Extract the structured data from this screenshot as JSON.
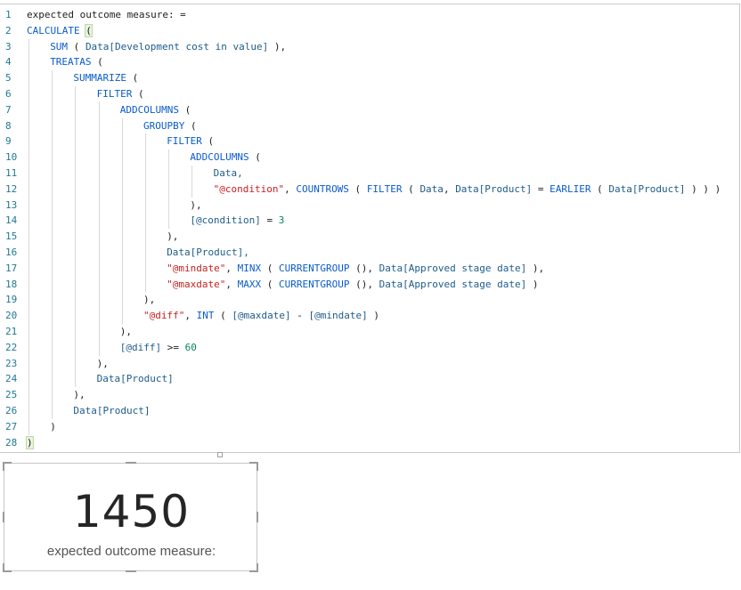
{
  "editor": {
    "lines": [
      {
        "n": "1",
        "indent": 0,
        "parts": [
          {
            "t": "expected outcome measure: =",
            "c": ""
          }
        ]
      },
      {
        "n": "2",
        "indent": 0,
        "parts": [
          {
            "t": "CALCULATE",
            "c": "kw"
          },
          {
            "t": " ",
            "c": ""
          },
          {
            "t": "(",
            "c": "bracket"
          }
        ]
      },
      {
        "n": "3",
        "indent": 1,
        "parts": [
          {
            "t": "SUM",
            "c": "kw"
          },
          {
            "t": " ( ",
            "c": ""
          },
          {
            "t": "Data[Development cost in value]",
            "c": "col"
          },
          {
            "t": " ),",
            "c": ""
          }
        ]
      },
      {
        "n": "4",
        "indent": 1,
        "parts": [
          {
            "t": "TREATAS",
            "c": "kw"
          },
          {
            "t": " (",
            "c": ""
          }
        ]
      },
      {
        "n": "5",
        "indent": 2,
        "parts": [
          {
            "t": "SUMMARIZE",
            "c": "kw"
          },
          {
            "t": " (",
            "c": ""
          }
        ]
      },
      {
        "n": "6",
        "indent": 3,
        "parts": [
          {
            "t": "FILTER",
            "c": "kw"
          },
          {
            "t": " (",
            "c": ""
          }
        ]
      },
      {
        "n": "7",
        "indent": 4,
        "parts": [
          {
            "t": "ADDCOLUMNS",
            "c": "kw"
          },
          {
            "t": " (",
            "c": ""
          }
        ]
      },
      {
        "n": "8",
        "indent": 5,
        "parts": [
          {
            "t": "GROUPBY",
            "c": "kw"
          },
          {
            "t": " (",
            "c": ""
          }
        ]
      },
      {
        "n": "9",
        "indent": 6,
        "parts": [
          {
            "t": "FILTER",
            "c": "kw"
          },
          {
            "t": " (",
            "c": ""
          }
        ]
      },
      {
        "n": "10",
        "indent": 7,
        "parts": [
          {
            "t": "ADDCOLUMNS",
            "c": "kw"
          },
          {
            "t": " (",
            "c": ""
          }
        ]
      },
      {
        "n": "11",
        "indent": 8,
        "parts": [
          {
            "t": "Data,",
            "c": "col"
          }
        ]
      },
      {
        "n": "12",
        "indent": 8,
        "parts": [
          {
            "t": "\"@condition\"",
            "c": "str"
          },
          {
            "t": ", ",
            "c": ""
          },
          {
            "t": "COUNTROWS",
            "c": "kw"
          },
          {
            "t": " ( ",
            "c": ""
          },
          {
            "t": "FILTER",
            "c": "kw"
          },
          {
            "t": " ( ",
            "c": ""
          },
          {
            "t": "Data",
            "c": "col"
          },
          {
            "t": ", ",
            "c": ""
          },
          {
            "t": "Data[Product]",
            "c": "col"
          },
          {
            "t": " = ",
            "c": ""
          },
          {
            "t": "EARLIER",
            "c": "kw"
          },
          {
            "t": " ( ",
            "c": ""
          },
          {
            "t": "Data[Product]",
            "c": "col"
          },
          {
            "t": " ) ) )",
            "c": ""
          }
        ]
      },
      {
        "n": "13",
        "indent": 7,
        "parts": [
          {
            "t": "),",
            "c": ""
          }
        ]
      },
      {
        "n": "14",
        "indent": 7,
        "parts": [
          {
            "t": "[@condition]",
            "c": "col"
          },
          {
            "t": " = ",
            "c": ""
          },
          {
            "t": "3",
            "c": "num"
          }
        ]
      },
      {
        "n": "15",
        "indent": 6,
        "parts": [
          {
            "t": "),",
            "c": ""
          }
        ]
      },
      {
        "n": "16",
        "indent": 6,
        "parts": [
          {
            "t": "Data[Product],",
            "c": "col"
          }
        ]
      },
      {
        "n": "17",
        "indent": 6,
        "parts": [
          {
            "t": "\"@mindate\"",
            "c": "str"
          },
          {
            "t": ", ",
            "c": ""
          },
          {
            "t": "MINX",
            "c": "kw"
          },
          {
            "t": " ( ",
            "c": ""
          },
          {
            "t": "CURRENTGROUP",
            "c": "kw"
          },
          {
            "t": " (), ",
            "c": ""
          },
          {
            "t": "Data[Approved stage date]",
            "c": "col"
          },
          {
            "t": " ),",
            "c": ""
          }
        ]
      },
      {
        "n": "18",
        "indent": 6,
        "parts": [
          {
            "t": "\"@maxdate\"",
            "c": "str"
          },
          {
            "t": ", ",
            "c": ""
          },
          {
            "t": "MAXX",
            "c": "kw"
          },
          {
            "t": " ( ",
            "c": ""
          },
          {
            "t": "CURRENTGROUP",
            "c": "kw"
          },
          {
            "t": " (), ",
            "c": ""
          },
          {
            "t": "Data[Approved stage date]",
            "c": "col"
          },
          {
            "t": " )",
            "c": ""
          }
        ]
      },
      {
        "n": "19",
        "indent": 5,
        "parts": [
          {
            "t": "),",
            "c": ""
          }
        ]
      },
      {
        "n": "20",
        "indent": 5,
        "parts": [
          {
            "t": "\"@diff\"",
            "c": "str"
          },
          {
            "t": ", ",
            "c": ""
          },
          {
            "t": "INT",
            "c": "kw"
          },
          {
            "t": " ( ",
            "c": ""
          },
          {
            "t": "[@maxdate]",
            "c": "col"
          },
          {
            "t": " - ",
            "c": ""
          },
          {
            "t": "[@mindate]",
            "c": "col"
          },
          {
            "t": " )",
            "c": ""
          }
        ]
      },
      {
        "n": "21",
        "indent": 4,
        "parts": [
          {
            "t": "),",
            "c": ""
          }
        ]
      },
      {
        "n": "22",
        "indent": 4,
        "parts": [
          {
            "t": "[@diff]",
            "c": "col"
          },
          {
            "t": " >= ",
            "c": ""
          },
          {
            "t": "60",
            "c": "num"
          }
        ]
      },
      {
        "n": "23",
        "indent": 3,
        "parts": [
          {
            "t": "),",
            "c": ""
          }
        ]
      },
      {
        "n": "24",
        "indent": 3,
        "parts": [
          {
            "t": "Data[Product]",
            "c": "col"
          }
        ]
      },
      {
        "n": "25",
        "indent": 2,
        "parts": [
          {
            "t": "),",
            "c": ""
          }
        ]
      },
      {
        "n": "26",
        "indent": 2,
        "parts": [
          {
            "t": "Data[Product]",
            "c": "col"
          }
        ]
      },
      {
        "n": "27",
        "indent": 1,
        "parts": [
          {
            "t": ")",
            "c": ""
          }
        ]
      },
      {
        "n": "28",
        "indent": 0,
        "parts": [
          {
            "t": ")",
            "c": "bracket"
          }
        ]
      }
    ]
  },
  "card": {
    "value": "1450",
    "label": "expected outcome measure:"
  },
  "colors": {
    "keyword": "#0a5bcc",
    "string": "#c92020",
    "number": "#098658",
    "line_number": "#237893"
  }
}
